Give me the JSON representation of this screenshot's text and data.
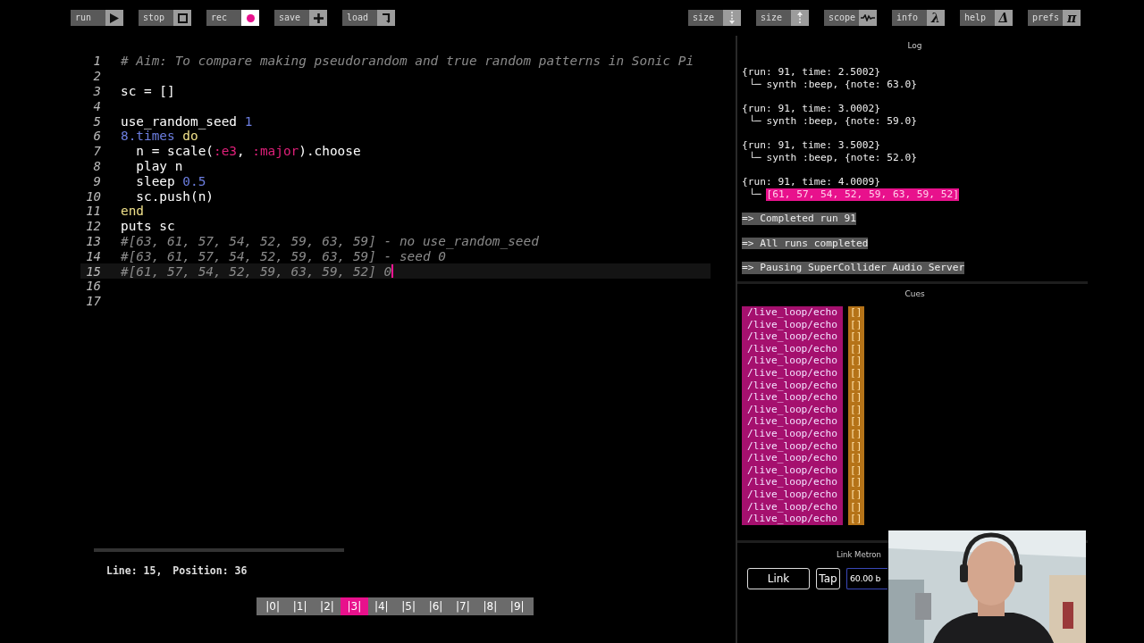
{
  "toolbar": {
    "left": [
      {
        "label": "run",
        "kind": "play"
      },
      {
        "label": "stop",
        "kind": "stop"
      },
      {
        "label": "rec",
        "kind": "record"
      },
      {
        "label": "save",
        "kind": "plus"
      },
      {
        "label": "load",
        "kind": "load"
      }
    ],
    "right": [
      {
        "label": "size",
        "kind": "size_down"
      },
      {
        "label": "size",
        "kind": "size_up"
      },
      {
        "label": "scope",
        "kind": "scope"
      },
      {
        "label": "info",
        "kind": "glyph",
        "glyph": "λ"
      },
      {
        "label": "help",
        "kind": "glyph",
        "glyph": "Δ"
      },
      {
        "label": "prefs",
        "kind": "glyph",
        "glyph": "π"
      }
    ]
  },
  "editor": {
    "lines": [
      {
        "number": "1",
        "current": false,
        "tokens": [
          {
            "kind": "comment",
            "text": "# Aim: To compare making pseudorandom and true random patterns in Sonic Pi"
          }
        ]
      },
      {
        "number": "2",
        "current": false
      },
      {
        "number": "3",
        "current": false,
        "tokens": [
          {
            "kind": "plain",
            "text": "sc = []"
          }
        ]
      },
      {
        "number": "4",
        "current": false
      },
      {
        "number": "5",
        "current": false,
        "tokens": [
          {
            "kind": "plain",
            "text": "use_random_seed "
          },
          {
            "kind": "number",
            "text": "1"
          }
        ]
      },
      {
        "number": "6",
        "current": false,
        "tokens": [
          {
            "kind": "number",
            "text": "8.times"
          },
          {
            "kind": "keyword",
            "text": " do"
          }
        ]
      },
      {
        "number": "7",
        "current": false,
        "tokens": [
          {
            "kind": "plain",
            "text": "  n = scale("
          },
          {
            "kind": "symbol",
            "text": ":e3"
          },
          {
            "kind": "plain",
            "text": ", "
          },
          {
            "kind": "symbol",
            "text": ":major"
          },
          {
            "kind": "plain",
            "text": ").choose"
          }
        ]
      },
      {
        "number": "8",
        "current": false,
        "tokens": [
          {
            "kind": "plain",
            "text": "  play n"
          }
        ]
      },
      {
        "number": "9",
        "current": false,
        "tokens": [
          {
            "kind": "plain",
            "text": "  sleep "
          },
          {
            "kind": "number",
            "text": "0.5"
          }
        ]
      },
      {
        "number": "10",
        "current": false,
        "tokens": [
          {
            "kind": "plain",
            "text": "  sc.push(n)"
          }
        ]
      },
      {
        "number": "11",
        "current": false,
        "tokens": [
          {
            "kind": "keyword",
            "text": "end"
          }
        ]
      },
      {
        "number": "12",
        "current": false,
        "tokens": [
          {
            "kind": "plain",
            "text": "puts sc"
          }
        ]
      },
      {
        "number": "13",
        "current": false,
        "tokens": [
          {
            "kind": "comment",
            "text": "#[63, 61, 57, 54, 52, 59, 63, 59] - no use_random_seed"
          }
        ]
      },
      {
        "number": "14",
        "current": false,
        "tokens": [
          {
            "kind": "comment",
            "text": "#[63, 61, 57, 54, 52, 59, 63, 59] - seed 0"
          }
        ]
      },
      {
        "number": "15",
        "current": true,
        "tokens": [
          {
            "kind": "comment",
            "text": "#[61, 57, 54, 52, 59, 63, 59, 52] 0"
          }
        ]
      },
      {
        "number": "16",
        "current": false
      },
      {
        "number": "17",
        "current": false
      }
    ],
    "status": {
      "line": "Line: 15,",
      "position": "Position: 36"
    },
    "workspaces": [
      {
        "label": "|0|",
        "selected": false
      },
      {
        "label": "|1|",
        "selected": false
      },
      {
        "label": "|2|",
        "selected": false
      },
      {
        "label": "|3|",
        "selected": true
      },
      {
        "label": "|4|",
        "selected": false
      },
      {
        "label": "|5|",
        "selected": false
      },
      {
        "label": "|6|",
        "selected": false
      },
      {
        "label": "|7|",
        "selected": false
      },
      {
        "label": "|8|",
        "selected": false
      },
      {
        "label": "|9|",
        "selected": false
      }
    ]
  },
  "log": {
    "title": "Log",
    "items": [
      {
        "kind": "entry",
        "header": "{run: 91, time: 2.5002}",
        "branch": "└─",
        "detail": "synth :beep, {note: 63.0}",
        "highlight": false
      },
      {
        "kind": "entry",
        "header": "{run: 91, time: 3.0002}",
        "branch": "└─",
        "detail": "synth :beep, {note: 59.0}",
        "highlight": false
      },
      {
        "kind": "entry",
        "header": "{run: 91, time: 3.5002}",
        "branch": "└─",
        "detail": "synth :beep, {note: 52.0}",
        "highlight": false
      },
      {
        "kind": "entry",
        "header": "{run: 91, time: 4.0009}",
        "branch": "└─",
        "detail": "[61, 57, 54, 52, 59, 63, 59, 52]",
        "highlight": true
      },
      {
        "kind": "message",
        "text": "=> Completed run 91"
      },
      {
        "kind": "message",
        "text": "=> All runs completed"
      },
      {
        "kind": "message",
        "text": "=> Pausing SuperCollider Audio Server"
      }
    ]
  },
  "cues": {
    "title": "Cues",
    "items": [
      {
        "path": "/live_loop/echo",
        "value": "[]"
      },
      {
        "path": "/live_loop/echo",
        "value": "[]"
      },
      {
        "path": "/live_loop/echo",
        "value": "[]"
      },
      {
        "path": "/live_loop/echo",
        "value": "[]"
      },
      {
        "path": "/live_loop/echo",
        "value": "[]"
      },
      {
        "path": "/live_loop/echo",
        "value": "[]"
      },
      {
        "path": "/live_loop/echo",
        "value": "[]"
      },
      {
        "path": "/live_loop/echo",
        "value": "[]"
      },
      {
        "path": "/live_loop/echo",
        "value": "[]"
      },
      {
        "path": "/live_loop/echo",
        "value": "[]"
      },
      {
        "path": "/live_loop/echo",
        "value": "[]"
      },
      {
        "path": "/live_loop/echo",
        "value": "[]"
      },
      {
        "path": "/live_loop/echo",
        "value": "[]"
      },
      {
        "path": "/live_loop/echo",
        "value": "[]"
      },
      {
        "path": "/live_loop/echo",
        "value": "[]"
      },
      {
        "path": "/live_loop/echo",
        "value": "[]"
      },
      {
        "path": "/live_loop/echo",
        "value": "[]"
      },
      {
        "path": "/live_loop/echo",
        "value": "[]"
      }
    ]
  },
  "metronome": {
    "title": "Link Metron",
    "link_button": "Link",
    "tap_button": "Tap",
    "bpm": "60.00 b"
  }
}
